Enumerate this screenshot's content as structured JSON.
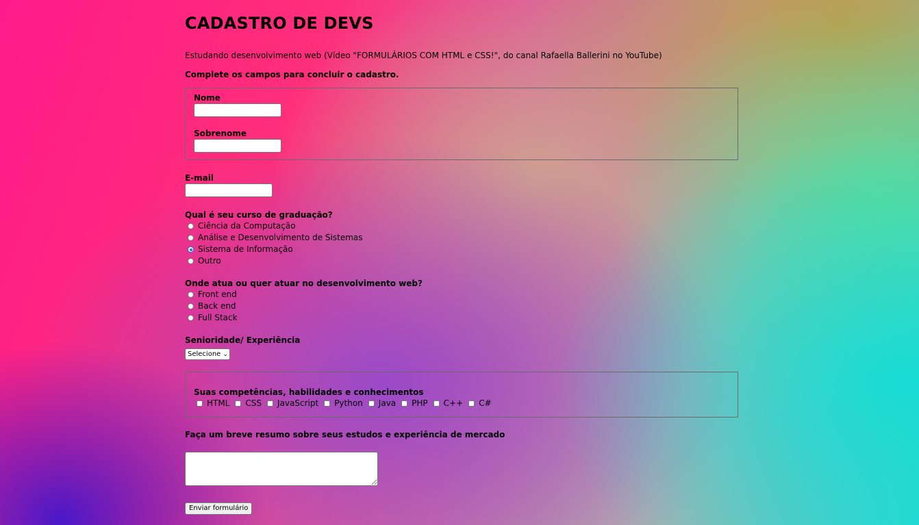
{
  "title": "CADASTRO DE DEVS",
  "intro": "Estudando desenvolvimento web (Vídeo \"FORMULÁRIOS COM HTML e CSS!\", do canal Rafaella Ballerini no YouTube)",
  "instructions": "Complete os campos para concluir o cadastro.",
  "fields": {
    "nome_label": "Nome",
    "nome_value": "",
    "sobrenome_label": "Sobrenome",
    "sobrenome_value": "",
    "email_label": "E-mail",
    "email_value": ""
  },
  "graduation": {
    "question": "Qual é seu curso de graduação?",
    "options": [
      "Ciência da Computação",
      "Análise e Desenvolvimento de Sistemas",
      "Sistema de Informação",
      "Outro"
    ],
    "selected": "Sistema de Informação"
  },
  "area": {
    "question": "Onde atua ou quer atuar no desenvolvimento web?",
    "options": [
      "Front end",
      "Back end",
      "Full Stack"
    ],
    "selected": null
  },
  "seniority": {
    "label": "Senioridade/ Experiência",
    "selected": "Selecione"
  },
  "skills": {
    "legend": "Suas competências, habilidades e conhecimentos",
    "options": [
      "HTML",
      "CSS",
      "JavaScript",
      "Python",
      "Java",
      "PHP",
      "C++",
      "C#"
    ]
  },
  "summary": {
    "label": "Faça um breve resumo sobre seus estudos e experiência de mercado",
    "value": ""
  },
  "submit_label": "Enviar formulário",
  "colors": {
    "radio_checked": "#1a73e8",
    "border": "#767676"
  }
}
